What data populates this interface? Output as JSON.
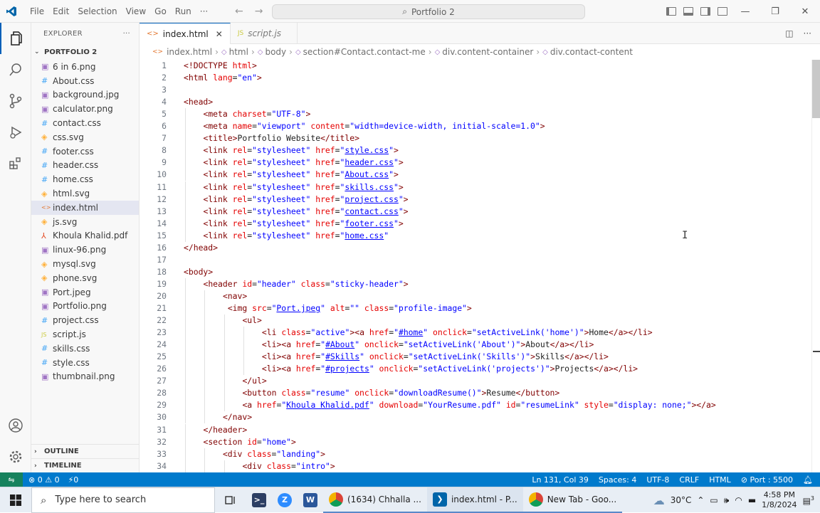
{
  "titlebar": {
    "menu": [
      "File",
      "Edit",
      "Selection",
      "View",
      "Go",
      "Run",
      "···"
    ],
    "search_text": "Portfolio 2"
  },
  "explorer": {
    "header": "EXPLORER",
    "more": "···",
    "folder": "PORTFOLIO 2",
    "files": [
      {
        "name": "6 in 6.png",
        "icon": "png-icon",
        "glyph": "▣"
      },
      {
        "name": "About.css",
        "icon": "css-icon",
        "glyph": "#"
      },
      {
        "name": "background.jpg",
        "icon": "png-icon",
        "glyph": "▣"
      },
      {
        "name": "calculator.png",
        "icon": "png-icon",
        "glyph": "▣"
      },
      {
        "name": "contact.css",
        "icon": "css-icon",
        "glyph": "#"
      },
      {
        "name": "css.svg",
        "icon": "svg-icon",
        "glyph": "◈"
      },
      {
        "name": "footer.css",
        "icon": "css-icon",
        "glyph": "#"
      },
      {
        "name": "header.css",
        "icon": "css-icon",
        "glyph": "#"
      },
      {
        "name": "home.css",
        "icon": "css-icon",
        "glyph": "#"
      },
      {
        "name": "html.svg",
        "icon": "svg-icon",
        "glyph": "◈"
      },
      {
        "name": "index.html",
        "icon": "html-icon",
        "glyph": "<>"
      },
      {
        "name": "js.svg",
        "icon": "svg-icon",
        "glyph": "◈"
      },
      {
        "name": "Khoula Khalid.pdf",
        "icon": "pdf-icon",
        "glyph": "⅄"
      },
      {
        "name": "linux-96.png",
        "icon": "png-icon",
        "glyph": "▣"
      },
      {
        "name": "mysql.svg",
        "icon": "svg-icon",
        "glyph": "◈"
      },
      {
        "name": "phone.svg",
        "icon": "svg-icon",
        "glyph": "◈"
      },
      {
        "name": "Port.jpeg",
        "icon": "png-icon",
        "glyph": "▣"
      },
      {
        "name": "Portfolio.png",
        "icon": "png-icon",
        "glyph": "▣"
      },
      {
        "name": "project.css",
        "icon": "css-icon",
        "glyph": "#"
      },
      {
        "name": "script.js",
        "icon": "js-icon",
        "glyph": "JS"
      },
      {
        "name": "skills.css",
        "icon": "css-icon",
        "glyph": "#"
      },
      {
        "name": "style.css",
        "icon": "css-icon",
        "glyph": "#"
      },
      {
        "name": "thumbnail.png",
        "icon": "png-icon",
        "glyph": "▣"
      }
    ],
    "selected": "index.html",
    "outline": "OUTLINE",
    "timeline": "TIMELINE"
  },
  "tabs": [
    {
      "label": "index.html",
      "active": true,
      "icon": "<>"
    },
    {
      "label": "script.js",
      "active": false,
      "icon": "JS"
    }
  ],
  "breadcrumb": [
    "index.html",
    "html",
    "body",
    "section#Contact.contact-me",
    "div.content-container",
    "div.contact-content"
  ],
  "code_lines": [
    {
      "n": "1",
      "indent": 0,
      "parts": [
        [
          "t",
          "<!DOCTYPE "
        ],
        [
          "a",
          "html"
        ],
        [
          "t",
          ">"
        ]
      ]
    },
    {
      "n": "2",
      "indent": 0,
      "parts": [
        [
          "t",
          "<html "
        ],
        [
          "a",
          "lang"
        ],
        [
          "x",
          "="
        ],
        [
          "v",
          "\"en\""
        ],
        [
          "t",
          ">"
        ]
      ]
    },
    {
      "n": "3",
      "indent": 0,
      "parts": []
    },
    {
      "n": "4",
      "indent": 0,
      "parts": [
        [
          "t",
          "<head>"
        ]
      ]
    },
    {
      "n": "5",
      "indent": 1,
      "parts": [
        [
          "t",
          "<meta "
        ],
        [
          "a",
          "charset"
        ],
        [
          "x",
          "="
        ],
        [
          "v",
          "\"UTF-8\""
        ],
        [
          "t",
          ">"
        ]
      ]
    },
    {
      "n": "6",
      "indent": 1,
      "parts": [
        [
          "t",
          "<meta "
        ],
        [
          "a",
          "name"
        ],
        [
          "x",
          "="
        ],
        [
          "v",
          "\"viewport\""
        ],
        [
          "x",
          " "
        ],
        [
          "a",
          "content"
        ],
        [
          "x",
          "="
        ],
        [
          "v",
          "\"width=device-width, initial-scale=1.0\""
        ],
        [
          "t",
          ">"
        ]
      ]
    },
    {
      "n": "7",
      "indent": 1,
      "parts": [
        [
          "t",
          "<title>"
        ],
        [
          "x",
          "Portfolio Website"
        ],
        [
          "t",
          "</title>"
        ]
      ]
    },
    {
      "n": "8",
      "indent": 1,
      "parts": [
        [
          "t",
          "<link "
        ],
        [
          "a",
          "rel"
        ],
        [
          "x",
          "="
        ],
        [
          "v",
          "\"stylesheet\""
        ],
        [
          "x",
          " "
        ],
        [
          "a",
          "href"
        ],
        [
          "x",
          "="
        ],
        [
          "v",
          "\""
        ],
        [
          "l",
          "style.css"
        ],
        [
          "v",
          "\""
        ],
        [
          "t",
          ">"
        ]
      ]
    },
    {
      "n": "9",
      "indent": 1,
      "parts": [
        [
          "t",
          "<link "
        ],
        [
          "a",
          "rel"
        ],
        [
          "x",
          "="
        ],
        [
          "v",
          "\"stylesheet\""
        ],
        [
          "x",
          " "
        ],
        [
          "a",
          "href"
        ],
        [
          "x",
          "="
        ],
        [
          "v",
          "\""
        ],
        [
          "l",
          "header.css"
        ],
        [
          "v",
          "\""
        ],
        [
          "t",
          ">"
        ]
      ]
    },
    {
      "n": "10",
      "indent": 1,
      "parts": [
        [
          "t",
          "<link "
        ],
        [
          "a",
          "rel"
        ],
        [
          "x",
          "="
        ],
        [
          "v",
          "\"stylesheet\""
        ],
        [
          "x",
          " "
        ],
        [
          "a",
          "href"
        ],
        [
          "x",
          "="
        ],
        [
          "v",
          "\""
        ],
        [
          "l",
          "About.css"
        ],
        [
          "v",
          "\""
        ],
        [
          "t",
          ">"
        ]
      ]
    },
    {
      "n": "11",
      "indent": 1,
      "parts": [
        [
          "t",
          "<link "
        ],
        [
          "a",
          "rel"
        ],
        [
          "x",
          "="
        ],
        [
          "v",
          "\"stylesheet\""
        ],
        [
          "x",
          " "
        ],
        [
          "a",
          "href"
        ],
        [
          "x",
          "="
        ],
        [
          "v",
          "\""
        ],
        [
          "l",
          "skills.css"
        ],
        [
          "v",
          "\""
        ],
        [
          "t",
          ">"
        ]
      ]
    },
    {
      "n": "12",
      "indent": 1,
      "parts": [
        [
          "t",
          "<link "
        ],
        [
          "a",
          "rel"
        ],
        [
          "x",
          "="
        ],
        [
          "v",
          "\"stylesheet\""
        ],
        [
          "x",
          " "
        ],
        [
          "a",
          "href"
        ],
        [
          "x",
          "="
        ],
        [
          "v",
          "\""
        ],
        [
          "l",
          "project.css"
        ],
        [
          "v",
          "\""
        ],
        [
          "t",
          ">"
        ]
      ]
    },
    {
      "n": "13",
      "indent": 1,
      "parts": [
        [
          "t",
          "<link "
        ],
        [
          "a",
          "rel"
        ],
        [
          "x",
          "="
        ],
        [
          "v",
          "\"stylesheet\""
        ],
        [
          "x",
          " "
        ],
        [
          "a",
          "href"
        ],
        [
          "x",
          "="
        ],
        [
          "v",
          "\""
        ],
        [
          "l",
          "contact.css"
        ],
        [
          "v",
          "\""
        ],
        [
          "t",
          ">"
        ]
      ]
    },
    {
      "n": "14",
      "indent": 1,
      "parts": [
        [
          "t",
          "<link "
        ],
        [
          "a",
          "rel"
        ],
        [
          "x",
          "="
        ],
        [
          "v",
          "\"stylesheet\""
        ],
        [
          "x",
          " "
        ],
        [
          "a",
          "href"
        ],
        [
          "x",
          "="
        ],
        [
          "v",
          "\""
        ],
        [
          "l",
          "footer.css"
        ],
        [
          "v",
          "\""
        ],
        [
          "t",
          ">"
        ]
      ]
    },
    {
      "n": "15",
      "indent": 1,
      "parts": [
        [
          "t",
          "<link "
        ],
        [
          "a",
          "rel"
        ],
        [
          "x",
          "="
        ],
        [
          "v",
          "\"stylesheet\""
        ],
        [
          "x",
          " "
        ],
        [
          "a",
          "href"
        ],
        [
          "x",
          "="
        ],
        [
          "v",
          "\""
        ],
        [
          "l",
          "home.css"
        ],
        [
          "v",
          "\""
        ]
      ]
    },
    {
      "n": "16",
      "indent": 0,
      "parts": [
        [
          "t",
          "</head>"
        ]
      ]
    },
    {
      "n": "17",
      "indent": 0,
      "parts": []
    },
    {
      "n": "18",
      "indent": 0,
      "parts": [
        [
          "t",
          "<body>"
        ]
      ]
    },
    {
      "n": "19",
      "indent": 1,
      "parts": [
        [
          "t",
          "<header "
        ],
        [
          "a",
          "id"
        ],
        [
          "x",
          "="
        ],
        [
          "v",
          "\"header\""
        ],
        [
          "x",
          " "
        ],
        [
          "a",
          "class"
        ],
        [
          "x",
          "="
        ],
        [
          "v",
          "\"sticky-header\""
        ],
        [
          "t",
          ">"
        ]
      ]
    },
    {
      "n": "20",
      "indent": 2,
      "parts": [
        [
          "t",
          "<nav>"
        ]
      ]
    },
    {
      "n": "21",
      "indent": 2,
      "pad": 1,
      "parts": [
        [
          "t",
          "<img "
        ],
        [
          "a",
          "src"
        ],
        [
          "x",
          "="
        ],
        [
          "v",
          "\""
        ],
        [
          "l",
          "Port.jpeg"
        ],
        [
          "v",
          "\""
        ],
        [
          "x",
          " "
        ],
        [
          "a",
          "alt"
        ],
        [
          "x",
          "="
        ],
        [
          "v",
          "\"\""
        ],
        [
          "x",
          " "
        ],
        [
          "a",
          "class"
        ],
        [
          "x",
          "="
        ],
        [
          "v",
          "\"profile-image\""
        ],
        [
          "t",
          ">"
        ]
      ]
    },
    {
      "n": "22",
      "indent": 3,
      "parts": [
        [
          "t",
          "<ul>"
        ]
      ]
    },
    {
      "n": "23",
      "indent": 4,
      "parts": [
        [
          "t",
          "<li "
        ],
        [
          "a",
          "class"
        ],
        [
          "x",
          "="
        ],
        [
          "v",
          "\"active\""
        ],
        [
          "t",
          "><a "
        ],
        [
          "a",
          "href"
        ],
        [
          "x",
          "="
        ],
        [
          "v",
          "\""
        ],
        [
          "l",
          "#home"
        ],
        [
          "v",
          "\""
        ],
        [
          "x",
          " "
        ],
        [
          "a",
          "onclick"
        ],
        [
          "x",
          "="
        ],
        [
          "v",
          "\"setActiveLink('home')\""
        ],
        [
          "t",
          ">"
        ],
        [
          "x",
          "Home"
        ],
        [
          "t",
          "</a></li>"
        ]
      ]
    },
    {
      "n": "24",
      "indent": 4,
      "parts": [
        [
          "t",
          "<li><a "
        ],
        [
          "a",
          "href"
        ],
        [
          "x",
          "="
        ],
        [
          "v",
          "\""
        ],
        [
          "l",
          "#About"
        ],
        [
          "v",
          "\""
        ],
        [
          "x",
          " "
        ],
        [
          "a",
          "onclick"
        ],
        [
          "x",
          "="
        ],
        [
          "v",
          "\"setActiveLink('About')\""
        ],
        [
          "t",
          ">"
        ],
        [
          "x",
          "About"
        ],
        [
          "t",
          "</a></li>"
        ]
      ]
    },
    {
      "n": "25",
      "indent": 4,
      "parts": [
        [
          "t",
          "<li><a "
        ],
        [
          "a",
          "href"
        ],
        [
          "x",
          "="
        ],
        [
          "v",
          "\""
        ],
        [
          "l",
          "#Skills"
        ],
        [
          "v",
          "\""
        ],
        [
          "x",
          " "
        ],
        [
          "a",
          "onclick"
        ],
        [
          "x",
          "="
        ],
        [
          "v",
          "\"setActiveLink('Skills')\""
        ],
        [
          "t",
          ">"
        ],
        [
          "x",
          "Skills"
        ],
        [
          "t",
          "</a></li>"
        ]
      ]
    },
    {
      "n": "26",
      "indent": 4,
      "parts": [
        [
          "t",
          "<li><a "
        ],
        [
          "a",
          "href"
        ],
        [
          "x",
          "="
        ],
        [
          "v",
          "\""
        ],
        [
          "l",
          "#projects"
        ],
        [
          "v",
          "\""
        ],
        [
          "x",
          " "
        ],
        [
          "a",
          "onclick"
        ],
        [
          "x",
          "="
        ],
        [
          "v",
          "\"setActiveLink('projects')\""
        ],
        [
          "t",
          ">"
        ],
        [
          "x",
          "Projects"
        ],
        [
          "t",
          "</a></li>"
        ]
      ]
    },
    {
      "n": "27",
      "indent": 3,
      "parts": [
        [
          "t",
          "</ul>"
        ]
      ]
    },
    {
      "n": "28",
      "indent": 3,
      "parts": [
        [
          "t",
          "<button "
        ],
        [
          "a",
          "class"
        ],
        [
          "x",
          "="
        ],
        [
          "v",
          "\"resume\""
        ],
        [
          "x",
          " "
        ],
        [
          "a",
          "onclick"
        ],
        [
          "x",
          "="
        ],
        [
          "v",
          "\"downloadResume()\""
        ],
        [
          "t",
          ">"
        ],
        [
          "x",
          "Resume"
        ],
        [
          "t",
          "</button>"
        ]
      ]
    },
    {
      "n": "29",
      "indent": 3,
      "parts": [
        [
          "t",
          "<a "
        ],
        [
          "a",
          "href"
        ],
        [
          "x",
          "="
        ],
        [
          "v",
          "\""
        ],
        [
          "l",
          "Khoula Khalid.pdf"
        ],
        [
          "v",
          "\""
        ],
        [
          "x",
          " "
        ],
        [
          "a",
          "download"
        ],
        [
          "x",
          "="
        ],
        [
          "v",
          "\"YourResume.pdf\""
        ],
        [
          "x",
          " "
        ],
        [
          "a",
          "id"
        ],
        [
          "x",
          "="
        ],
        [
          "v",
          "\"resumeLink\""
        ],
        [
          "x",
          " "
        ],
        [
          "a",
          "style"
        ],
        [
          "x",
          "="
        ],
        [
          "v",
          "\"display: none;\""
        ],
        [
          "t",
          "></a>"
        ]
      ]
    },
    {
      "n": "30",
      "indent": 2,
      "parts": [
        [
          "t",
          "</nav>"
        ]
      ]
    },
    {
      "n": "31",
      "indent": 1,
      "parts": [
        [
          "t",
          "</header>"
        ]
      ]
    },
    {
      "n": "32",
      "indent": 1,
      "parts": [
        [
          "t",
          "<section "
        ],
        [
          "a",
          "id"
        ],
        [
          "x",
          "="
        ],
        [
          "v",
          "\"home\""
        ],
        [
          "t",
          ">"
        ]
      ]
    },
    {
      "n": "33",
      "indent": 2,
      "parts": [
        [
          "t",
          "<div "
        ],
        [
          "a",
          "class"
        ],
        [
          "x",
          "="
        ],
        [
          "v",
          "\"landing\""
        ],
        [
          "t",
          ">"
        ]
      ]
    },
    {
      "n": "34",
      "indent": 3,
      "parts": [
        [
          "t",
          "<div "
        ],
        [
          "a",
          "class"
        ],
        [
          "x",
          "="
        ],
        [
          "v",
          "\"intro\""
        ],
        [
          "t",
          ">"
        ]
      ]
    }
  ],
  "statusbar": {
    "errors": "⊗ 0 ⚠ 0",
    "ports": "⚡0",
    "position": "Ln 131, Col 39",
    "spaces": "Spaces: 4",
    "encoding": "UTF-8",
    "eol": "CRLF",
    "language": "HTML",
    "port": "⊘ Port : 5500"
  },
  "taskbar": {
    "search_placeholder": "Type here to search",
    "apps": [
      {
        "label": "(1634) Chhalla ...",
        "icon": "chrome-icon"
      },
      {
        "label": "index.html - P...",
        "icon": "vscode-icon"
      },
      {
        "label": "New Tab - Goo...",
        "icon": "chrome-icon"
      }
    ],
    "weather": "30°C",
    "time": "4:58 PM",
    "date": "1/8/2024",
    "notifications": "3"
  },
  "colors": {
    "accent": "#005fb8",
    "status_bar": "#007acc",
    "remote": "#16825d",
    "tag": "#800000",
    "attr": "#e50000",
    "value": "#0000ff"
  }
}
